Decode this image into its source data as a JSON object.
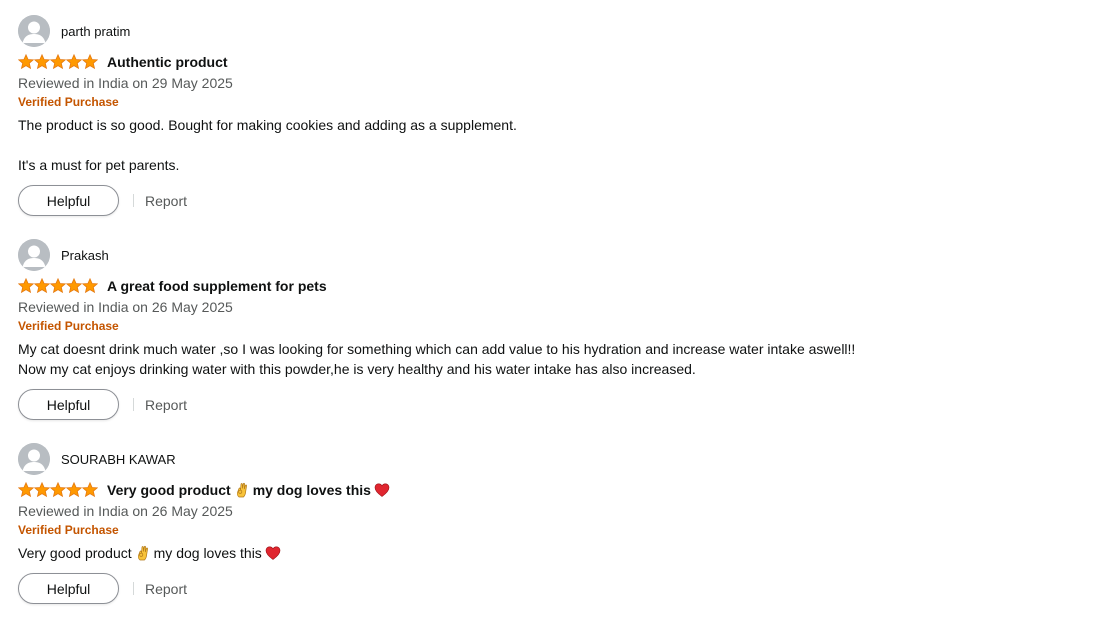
{
  "reviews": [
    {
      "profile_name": "parth pratim",
      "rating_stars": 5,
      "title": "Authentic product",
      "date": "Reviewed in India on 29 May 2025",
      "verified": "Verified Purchase",
      "body_line_1": "The product is so good. Bought for making cookies and adding as a supplement.",
      "body_line_2": "It's a must for pet parents.",
      "helpful_label": "Helpful",
      "report_label": "Report"
    },
    {
      "profile_name": "Prakash",
      "rating_stars": 5,
      "title": "A great food supplement for pets",
      "date": "Reviewed in India on 26 May 2025",
      "verified": "Verified Purchase",
      "body_line_1": "My cat doesnt drink much water ,so I was looking for something which can add value to his hydration and increase water intake aswell!!",
      "body_line_2": "Now my cat enjoys drinking water with this powder,he is very healthy and his water intake has also increased.",
      "helpful_label": "Helpful",
      "report_label": "Report"
    },
    {
      "profile_name": "SOURABH KAWAR",
      "rating_stars": 5,
      "title_part_1": "Very good product",
      "title_part_2": "my dog loves this",
      "date": "Reviewed in India on 26 May 2025",
      "verified": "Verified Purchase",
      "body_part_1": "Very good product",
      "body_part_2": "my dog loves this",
      "helpful_label": "Helpful",
      "report_label": "Report"
    }
  ],
  "colors": {
    "star": "#ff9900",
    "star_outline": "#e47911",
    "verified": "#c45500",
    "date": "#565959",
    "text": "#0f1111"
  },
  "icons": {
    "avatar": "default-user-avatar-icon",
    "star": "filled-star-icon",
    "ok_hand": "ok-hand-emoji-icon",
    "heart": "red-heart-emoji-icon"
  }
}
